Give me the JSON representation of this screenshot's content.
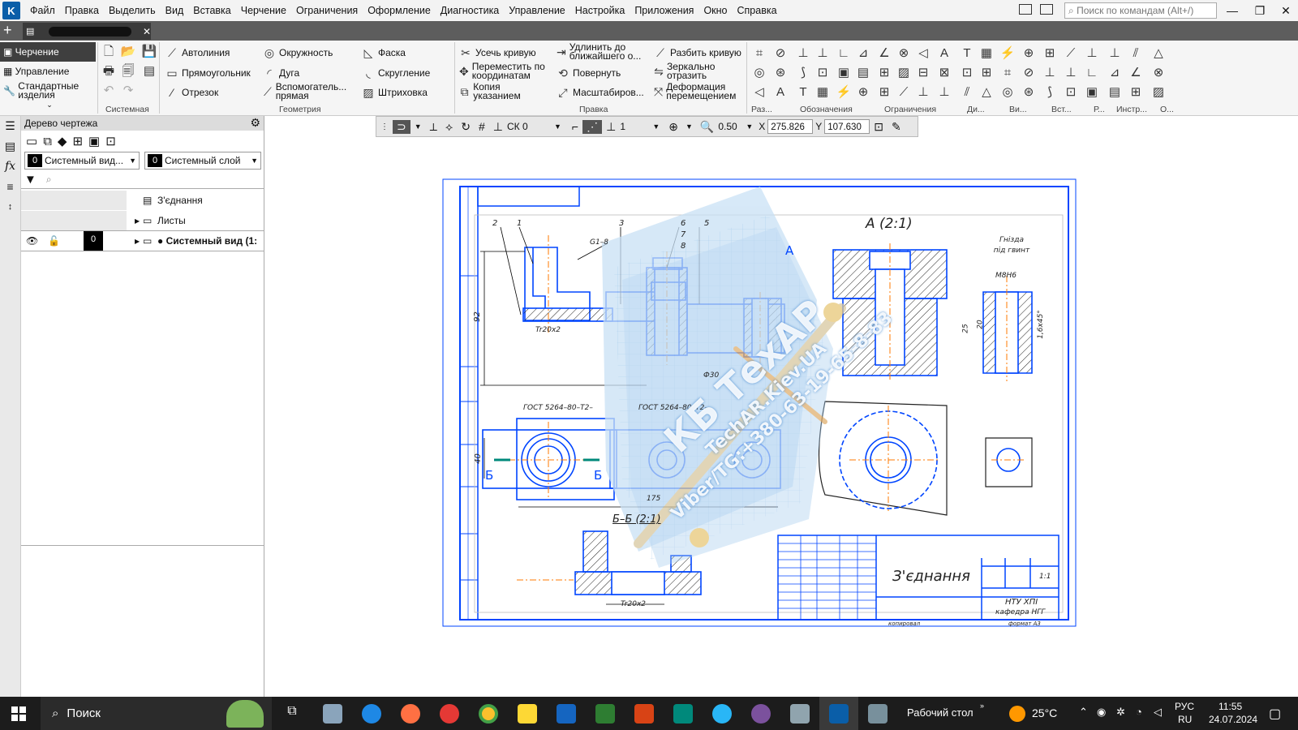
{
  "menu": [
    "Файл",
    "Правка",
    "Выделить",
    "Вид",
    "Вставка",
    "Черчение",
    "Ограничения",
    "Оформление",
    "Диагностика",
    "Управление",
    "Настройка",
    "Приложения",
    "Окно",
    "Справка"
  ],
  "search_placeholder": "Поиск по командам (Alt+/)",
  "ribbon_left": [
    "Черчение",
    "Управление",
    "Стандартные изделия"
  ],
  "geometry": [
    "Автолиния",
    "Прямоугольник",
    "Отрезок",
    "Окружность",
    "Дуга",
    "Вспомогатель... прямая",
    "Фаска",
    "Скругление",
    "Штриховка"
  ],
  "edit": [
    "Усечь кривую",
    "Переместить по координатам",
    "Копия указанием",
    "Удлинить до ближайшего о...",
    "Повернуть",
    "Масштабиров...",
    "Разбить кривую",
    "Зеркально отразить",
    "Деформация перемещением"
  ],
  "groups": [
    "Системная",
    "Геометрия",
    "Правка",
    "Раз...",
    "Обозначения",
    "Ограничения",
    "Ди...",
    "Ви...",
    "Вст...",
    "Р...",
    "Инстр...",
    "О..."
  ],
  "tree": {
    "title": "Дерево чертежа",
    "view_num": "0",
    "view_name": "Системный вид...",
    "layer_num": "0",
    "layer_name": "Системный слой",
    "items": [
      "З'єднання",
      "Листы",
      "● Системный вид (1:"
    ]
  },
  "cad": {
    "sk": "СК 0",
    "step": "1",
    "scale": "0.50",
    "x": "275.826",
    "y": "107.630"
  },
  "drawing": {
    "title": "З'єднання",
    "view_a": "A (2:1)",
    "view_b": "Б–Б (2:1)",
    "niche": "Гнізда під гвинт",
    "gost1": "ГОСТ 5264–80–Т2–",
    "gost2": "ГОСТ 5264–80–Т2–",
    "thread1": "Tr20x2",
    "thread2": "Tr20x2",
    "m": "М8Н6",
    "dim_92": "92",
    "dim_40": "40",
    "dim_175": "175",
    "dim_phi30": "Ф30",
    "dim_25": "25",
    "dim_20": "20",
    "dim_cham": "1,6х45°",
    "g": "G1–8",
    "arrow_a": "A",
    "arrow_b": "Б",
    "univ": "НТУ ХПІ",
    "dept": "кафедра НГГ",
    "format": "формат А3",
    "sheet": "1:1",
    "copy": "копировал",
    "callouts": [
      "2",
      "1",
      "3",
      "6",
      "5",
      "7",
      "8"
    ]
  },
  "watermark": [
    "КБ ТехАР",
    "TechAR.Kiev.UA",
    "Viber/TG:+380-63-19-65-8-83"
  ],
  "taskbar": {
    "search": "Поиск",
    "desktop": "Рабочий стол",
    "temp": "25°C",
    "lang1": "РУС",
    "lang2": "RU",
    "time": "11:55",
    "date": "24.07.2024"
  }
}
